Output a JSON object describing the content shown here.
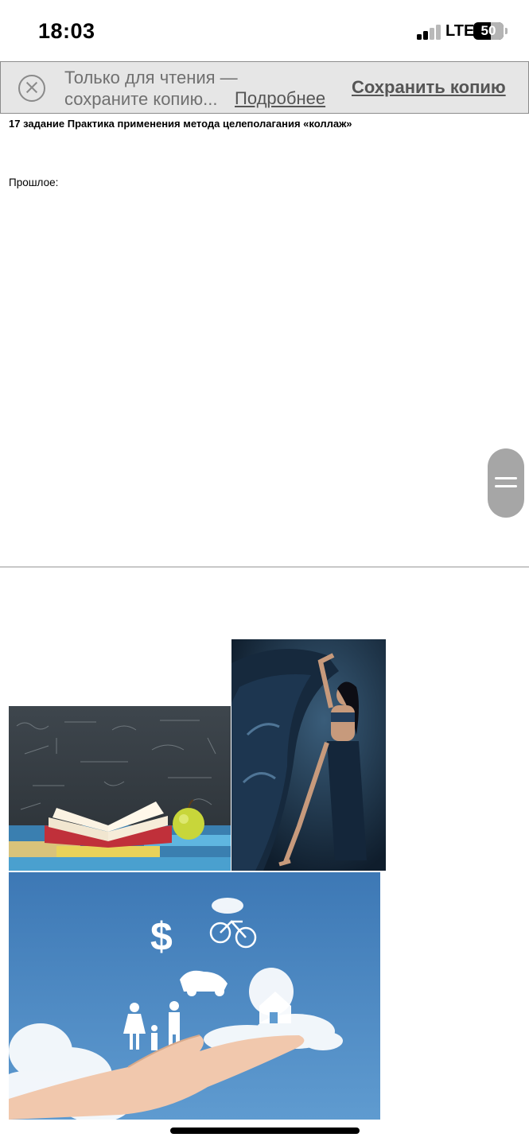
{
  "status_bar": {
    "time": "18:03",
    "network": "LTE",
    "battery": "50"
  },
  "banner": {
    "message": "Только для чтения — сохраните копию...",
    "details_link": "Подробнее",
    "save_copy": "Сохранить копию",
    "close_icon": "close-circle-icon"
  },
  "document": {
    "title": "17 задание Практика применения метода целеполагания «коллаж»",
    "past_label": "Прошлое:"
  },
  "collage": {
    "images": [
      "books-chalkboard-apple",
      "dancer-blue-silk",
      "cloud-dreams-hand"
    ]
  },
  "colors": {
    "banner_bg": "#e6e6e6",
    "link": "#555555"
  }
}
